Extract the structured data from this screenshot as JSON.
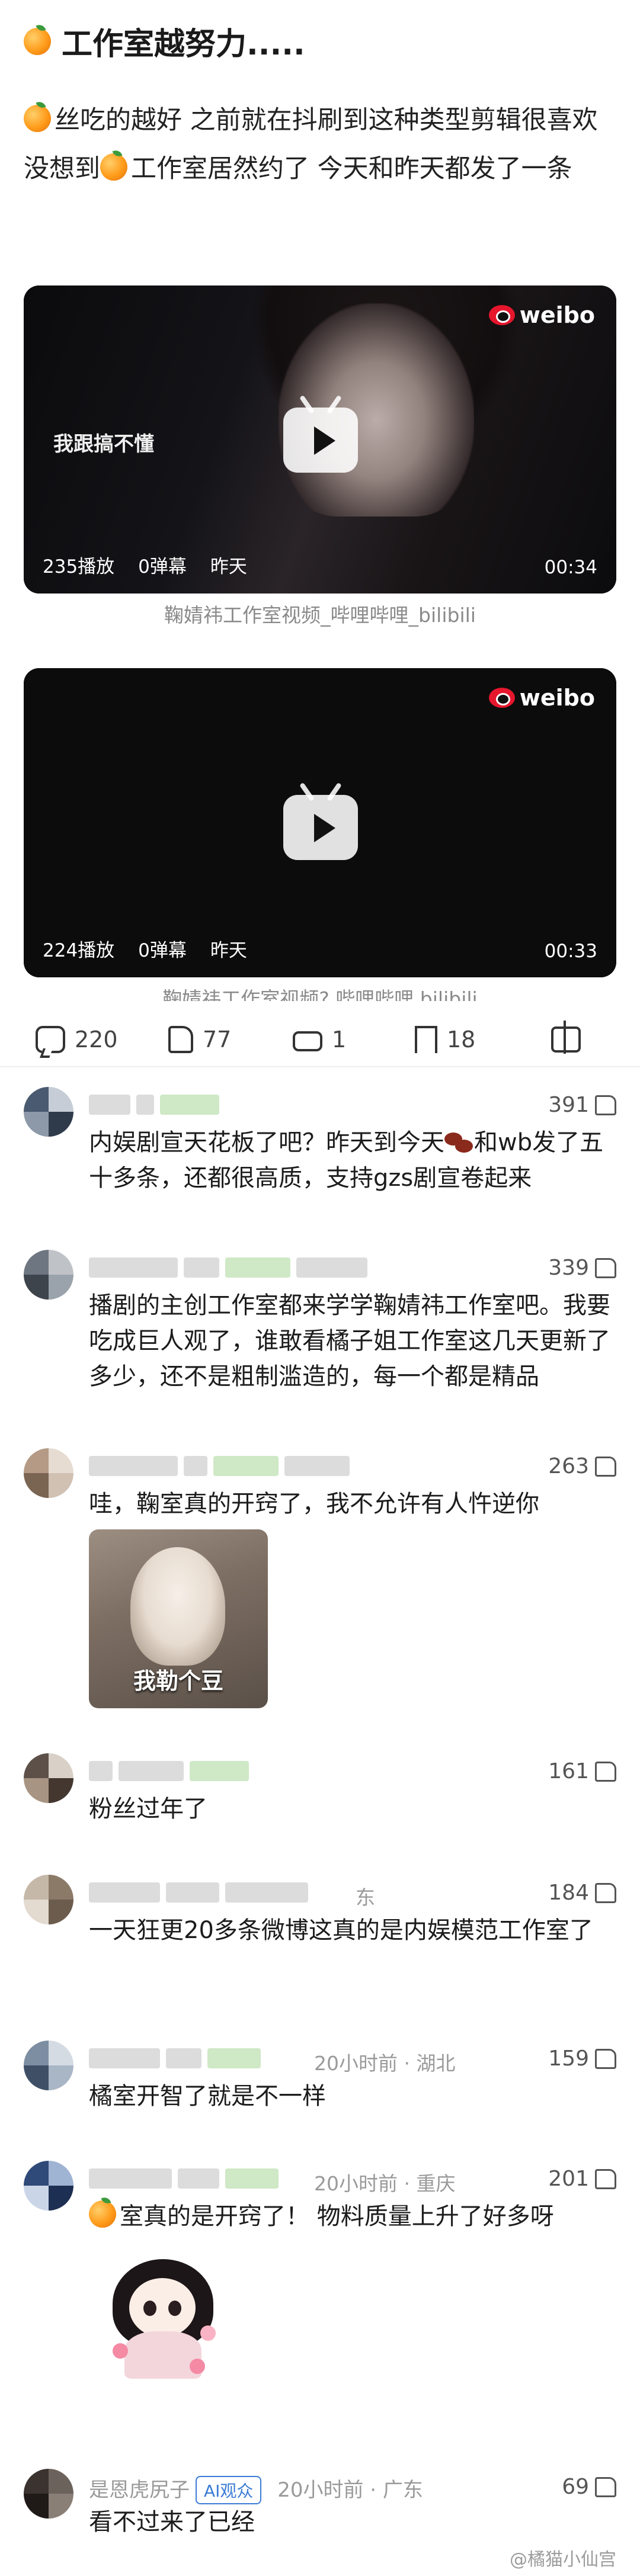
{
  "post": {
    "title": "工作室越努力.....",
    "body_prefix": "丝吃的越好 之前就在抖刷到这种类型剪辑很喜欢 没想到",
    "body_suffix": "工作室居然约了 今天和昨天都发了一条"
  },
  "videos": [
    {
      "brand": "weibo",
      "subtitle": "我跟搞不懂",
      "plays": "235播放",
      "danmaku": "0弹幕",
      "date": "昨天",
      "duration": "00:34",
      "source": "鞠婧祎工作室视频_哔哩哔哩_bilibili"
    },
    {
      "brand": "weibo",
      "plays": "224播放",
      "danmaku": "0弹幕",
      "date": "昨天",
      "duration": "00:33",
      "source": "鞠婧祎工作室视频? 哔哩哔哩 bilibili"
    }
  ],
  "actions": {
    "comments": "220",
    "likes": "77",
    "reposts": "1",
    "favorites": "18"
  },
  "comments": [
    {
      "likes": "391",
      "text_part1": "内娱剧宣天花板了吧？昨天到今天",
      "text_part2": "和wb发了五十多条，还都很高质，支持gzs剧宣卷起来"
    },
    {
      "likes": "339",
      "text": "播剧的主创工作室都来学学鞠婧祎工作室吧。我要吃成巨人观了，谁敢看橘子姐工作室这几天更新了多少，还不是粗制滥造的，每一个都是精品"
    },
    {
      "likes": "263",
      "text": "哇，鞠室真的开窍了，我不允许有人忤逆你",
      "sticker_caption": "我勒个豆"
    },
    {
      "likes": "161",
      "text": "粉丝过年了"
    },
    {
      "meta": "东",
      "likes": "184",
      "text": "一天狂更20多条微博这真的是内娱模范工作室了"
    },
    {
      "meta": "20小时前 · 湖北",
      "likes": "159",
      "text": "橘室开智了就是不一样"
    },
    {
      "meta": "20小时前 · 重庆",
      "likes": "201",
      "text": "室真的是开窍了！ 物料质量上升了好多呀"
    },
    {
      "name": "是恩虎尻子",
      "ai_tag": "AI观众",
      "meta": "20小时前 · 广东",
      "likes": "69",
      "text": "看不过来了已经"
    }
  ],
  "watermark": "@橘猫小仙宫"
}
